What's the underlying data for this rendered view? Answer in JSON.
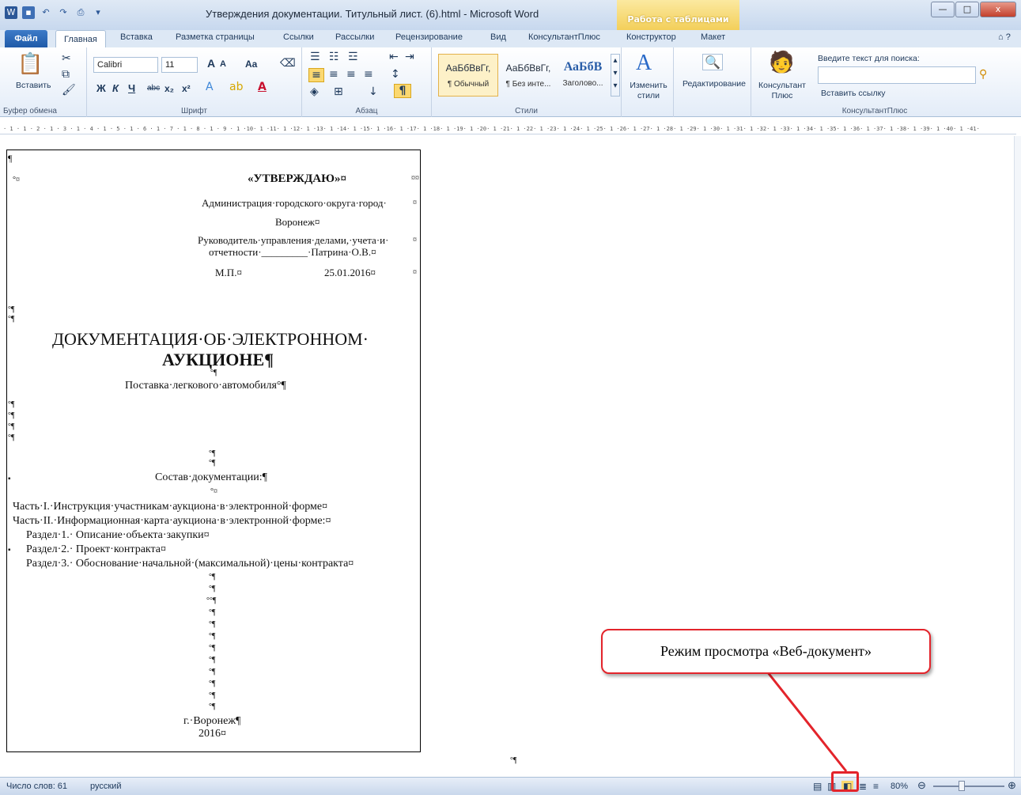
{
  "window": {
    "title": "Утверждения документации. Титульный лист. (6).html - Microsoft Word",
    "context_tab_group": "Работа с таблицами",
    "controls": {
      "minimize": "—",
      "maximize": "□",
      "close": "x"
    }
  },
  "tabs": [
    "Файл",
    "Главная",
    "Вставка",
    "Разметка страницы",
    "Ссылки",
    "Рассылки",
    "Рецензирование",
    "Вид",
    "КонсультантПлюс",
    "Конструктор",
    "Макет"
  ],
  "active_tab": "Главная",
  "ribbon": {
    "clipboard": {
      "paste": "Вставить",
      "label": "Буфер обмена"
    },
    "font": {
      "name": "Calibri",
      "size": "11",
      "label": "Шрифт",
      "buttons": {
        "bold": "Ж",
        "italic": "К",
        "underline": "Ч",
        "strike": "abc",
        "sub": "x₂",
        "sup": "x²",
        "grow": "A",
        "shrink": "A",
        "case": "Aa"
      }
    },
    "paragraph": {
      "label": "Абзац",
      "show_marks": "¶"
    },
    "styles": {
      "label": "Стили",
      "items": [
        {
          "sample": "АаБбВвГг,",
          "name": "¶ Обычный"
        },
        {
          "sample": "АаБбВвГг,",
          "name": "¶ Без инте..."
        },
        {
          "sample": "АаБбВ",
          "name": "Заголово..."
        }
      ],
      "change": "Изменить стили"
    },
    "editing": {
      "label": "Редактирование"
    },
    "consultant": {
      "button": "Консультант Плюс",
      "search_placeholder": "Введите текст для поиска:",
      "insert_link": "Вставить ссылку",
      "label": "КонсультантПлюс"
    }
  },
  "ruler": "· 1 · 1 · 2 · 1 · 3 · 1 · 4 · 1 · 5 · 1 · 6 · 1 · 7 · 1 · 8 · 1 · 9 · 1 ·10· 1 ·11· 1 ·12· 1 ·13· 1 ·14· 1 ·15· 1 ·16· 1 ·17· 1 ·18· 1 ·19· 1 ·20· 1 ·21· 1 ·22· 1 ·23· 1 ·24· 1 ·25· 1 ·26· 1 ·27· 1 ·28· 1 ·29· 1 ·30· 1 ·31· 1 ·32· 1 ·33· 1 ·34· 1 ·35· 1 ·36· 1 ·37· 1 ·38· 1 ·39· 1 ·40· 1 ·41·",
  "document": {
    "approve": "«УТВЕРЖДАЮ»¤",
    "admin": "Администрация·городского·округа·город·",
    "city": "Воронеж¤",
    "head_line1": "Руководитель·управления·делами,·учета·и·",
    "head_line2": "отчетности·_________·Патрина·О.В.¤",
    "mp": "М.П.¤",
    "date": "25.01.2016¤",
    "title_line1": "ДОКУМЕНТАЦИЯ·ОБ·ЭЛЕКТРОННОМ·",
    "title_line2": "АУКЦИОНЕ¶",
    "subject": "Поставка·легкового·автомобиля°¶",
    "contents_title": "Состав·документации:¶",
    "part1": "Часть·I.·Инструкция·участникам·аукциона·в·электронной·форме¤",
    "part2": "Часть·II.·Информационная·карта·аукциона·в·электронной·форме:¤",
    "section1": "Раздел·1.·  Описание·объекта·закупки¤",
    "section2": "Раздел·2.·  Проект·контракта¤",
    "section3": "Раздел·3.·  Обоснование·начальной·(максимальной)·цены·контракта¤",
    "place": "г.·Воронеж¶",
    "year": "2016¤",
    "pilcrow": "¶",
    "deg_pilcrow": "°¶",
    "deg_cell": "°¤",
    "cell_end": "¤",
    "double_cell": "¤¤",
    "degdeg": "°°¶"
  },
  "callout": "Режим  просмотра «Веб-документ»",
  "status": {
    "words": "Число слов: 61",
    "language": "русский",
    "zoom": "80%"
  },
  "colors": {
    "callout_border": "#e3242b",
    "ribbon_accent": "#1f5aa8"
  }
}
